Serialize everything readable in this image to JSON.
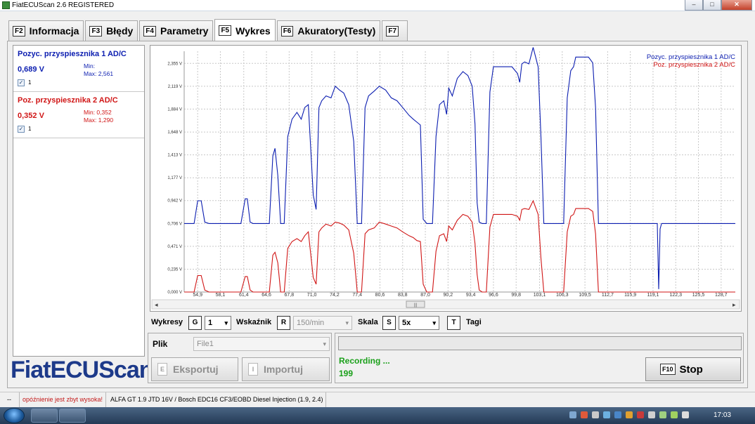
{
  "window": {
    "title": "FiatECUScan 2.6 REGISTERED",
    "minimize": "–",
    "maximize": "□",
    "close": "✕"
  },
  "tabs": [
    {
      "key": "F2",
      "label": "Informacja"
    },
    {
      "key": "F3",
      "label": "Błędy"
    },
    {
      "key": "F4",
      "label": "Parametry"
    },
    {
      "key": "F5",
      "label": "Wykres"
    },
    {
      "key": "F6",
      "label": "Akuratory(Testy)"
    },
    {
      "key": "F7",
      "label": ""
    }
  ],
  "channels": [
    {
      "name": "Pozyc. przyspiesznika 1 AD/C",
      "value": "0,689 V",
      "min": "Min:",
      "max": "Max: 2,561",
      "checked": "✓",
      "check_label": "1",
      "color": "#0b1db0"
    },
    {
      "name": "Poz. przyspiesznika 2 AD/C",
      "value": "0,352 V",
      "min": "Min: 0,352",
      "max": "Max: 1,290",
      "checked": "✓",
      "check_label": "1",
      "color": "#d01515"
    }
  ],
  "logo": "FiatECUScan",
  "chart_data": {
    "type": "line",
    "legend_position": "top-right",
    "grid": true,
    "xlim": [
      53.0,
      130.7
    ],
    "ylim": [
      0.0,
      2.48
    ],
    "y_ticks": [
      "0,000 V",
      "0,235 V",
      "0,471 V",
      "0,706 V",
      "0,942 V",
      "1,177 V",
      "1,413 V",
      "1,648 V",
      "1,884 V",
      "2,119 V",
      "2,355 V"
    ],
    "x_ticks": [
      "54,9",
      "58,1",
      "61,4",
      "64,6",
      "67,8",
      "71,0",
      "74,2",
      "77,4",
      "80,6",
      "83,8",
      "87,0",
      "90,2",
      "93,4",
      "96,6",
      "99,8",
      "103,1",
      "106,3",
      "109,5",
      "112,7",
      "115,9",
      "119,1",
      "122,3",
      "125,5",
      "128,7"
    ],
    "series": [
      {
        "name": "Pozyc. przyspiesznika 1 AD/C",
        "color": "#0b1db0",
        "x": [
          53.0,
          54.4,
          54.9,
          55.4,
          55.9,
          56.5,
          58.1,
          61.0,
          61.6,
          61.9,
          62.3,
          62.7,
          63.6,
          64.3,
          65.0,
          65.5,
          65.8,
          66.2,
          66.6,
          67.1,
          67.6,
          68.2,
          68.9,
          69.5,
          70.0,
          70.5,
          71.2,
          71.6,
          72.0,
          72.4,
          73.0,
          73.7,
          74.3,
          74.9,
          75.5,
          76.2,
          76.9,
          77.4,
          78.0,
          78.5,
          79.0,
          79.8,
          80.5,
          81.4,
          82.2,
          83.0,
          83.8,
          84.7,
          85.3,
          85.8,
          86.3,
          86.7,
          87.2,
          87.6,
          88.0,
          88.5,
          89.0,
          89.6,
          90.0,
          90.3,
          90.8,
          91.5,
          92.3,
          93.0,
          93.6,
          94.0,
          94.3,
          94.6,
          95.0,
          95.6,
          96.1,
          96.6,
          97.0,
          97.6,
          98.4,
          99.2,
          100.0,
          100.3,
          100.6,
          101.0,
          101.6,
          102.2,
          102.9,
          103.3,
          103.7,
          104.2,
          104.7,
          105.1,
          106.5,
          107.0,
          107.5,
          107.9,
          108.2,
          108.7,
          109.4,
          110.0,
          110.6,
          111.0,
          111.4,
          111.8,
          112.5,
          115.0,
          118.0,
          119.5,
          119.7,
          119.9,
          120.1,
          120.3,
          121.0,
          125.0,
          130.7
        ],
        "y": [
          0.706,
          0.706,
          0.94,
          0.94,
          0.72,
          0.706,
          0.706,
          0.706,
          0.96,
          0.96,
          0.72,
          0.706,
          0.706,
          0.706,
          0.706,
          1.4,
          1.48,
          1.2,
          0.706,
          0.706,
          1.6,
          1.78,
          1.85,
          1.78,
          1.9,
          1.93,
          1.0,
          0.85,
          1.9,
          1.97,
          2.02,
          2.0,
          2.12,
          2.08,
          2.05,
          1.93,
          1.55,
          0.706,
          0.706,
          1.9,
          2.02,
          2.07,
          2.12,
          2.08,
          2.0,
          1.97,
          1.9,
          1.82,
          1.78,
          1.75,
          1.72,
          0.75,
          0.706,
          0.706,
          0.706,
          1.6,
          1.93,
          1.97,
          1.83,
          2.1,
          2.02,
          2.2,
          2.27,
          2.23,
          2.12,
          1.73,
          0.92,
          0.72,
          0.706,
          0.706,
          2.06,
          2.32,
          2.32,
          2.32,
          2.32,
          2.32,
          2.25,
          2.16,
          2.35,
          2.37,
          2.35,
          2.52,
          2.32,
          1.6,
          0.706,
          0.706,
          0.706,
          0.706,
          0.706,
          2.0,
          2.28,
          2.32,
          2.42,
          2.42,
          2.42,
          2.42,
          2.36,
          1.9,
          0.706,
          0.706,
          0.706,
          0.706,
          0.706,
          0.706,
          0.706,
          0.03,
          0.65,
          0.706,
          0.706,
          0.706,
          0.706
        ],
        "legend": "Pozyc. przyspiesznika 1 AD/C"
      },
      {
        "name": "Poz. przyspiesznika 2 AD/C",
        "color": "#d01515",
        "x": [
          53.0,
          54.4,
          54.9,
          55.4,
          55.9,
          56.5,
          58.1,
          61.0,
          61.6,
          61.9,
          62.3,
          62.7,
          63.6,
          64.3,
          65.0,
          65.5,
          65.8,
          66.2,
          66.6,
          67.1,
          67.6,
          68.2,
          68.9,
          69.5,
          70.0,
          70.5,
          71.2,
          71.6,
          72.0,
          72.4,
          73.0,
          73.7,
          74.3,
          74.9,
          75.5,
          76.2,
          76.9,
          77.4,
          78.0,
          78.5,
          79.0,
          79.8,
          80.5,
          81.4,
          82.2,
          83.0,
          83.8,
          84.7,
          85.3,
          85.8,
          86.3,
          86.7,
          87.2,
          87.6,
          88.0,
          88.5,
          89.0,
          89.6,
          90.0,
          90.3,
          90.8,
          91.5,
          92.3,
          93.0,
          93.6,
          94.0,
          94.3,
          94.6,
          95.0,
          95.6,
          96.1,
          96.6,
          97.0,
          97.6,
          98.4,
          99.2,
          100.0,
          100.3,
          100.6,
          101.0,
          101.6,
          102.2,
          102.9,
          103.3,
          103.7,
          104.2,
          104.7,
          105.1,
          106.5,
          107.0,
          107.5,
          107.9,
          108.2,
          108.7,
          109.4,
          110.0,
          110.6,
          111.0,
          111.4,
          111.8,
          112.5,
          130.7
        ],
        "y": [
          0.0,
          0.0,
          0.17,
          0.17,
          0.02,
          0.0,
          0.0,
          0.0,
          0.16,
          0.16,
          0.02,
          0.0,
          0.0,
          0.0,
          0.0,
          0.38,
          0.41,
          0.3,
          0.0,
          0.0,
          0.45,
          0.52,
          0.55,
          0.52,
          0.58,
          0.62,
          0.15,
          0.08,
          0.62,
          0.66,
          0.7,
          0.68,
          0.72,
          0.71,
          0.69,
          0.64,
          0.4,
          0.0,
          0.0,
          0.6,
          0.64,
          0.66,
          0.72,
          0.7,
          0.68,
          0.66,
          0.62,
          0.58,
          0.56,
          0.53,
          0.52,
          0.08,
          0.0,
          0.0,
          0.0,
          0.42,
          0.58,
          0.6,
          0.52,
          0.68,
          0.64,
          0.74,
          0.8,
          0.78,
          0.72,
          0.5,
          0.18,
          0.02,
          0.0,
          0.0,
          0.67,
          0.8,
          0.8,
          0.8,
          0.8,
          0.8,
          0.78,
          0.74,
          0.85,
          0.86,
          0.85,
          0.94,
          0.8,
          0.35,
          0.0,
          0.0,
          0.0,
          0.0,
          0.0,
          0.62,
          0.78,
          0.8,
          0.86,
          0.86,
          0.86,
          0.86,
          0.83,
          0.6,
          0.0,
          0.0,
          0.0,
          0.0
        ],
        "legend": "Poz. przyspiesznika 2 AD/C"
      }
    ]
  },
  "scrollbar": {
    "left": "◂",
    "right": "▸",
    "grip": "|||"
  },
  "controls": {
    "charts_label": "Wykresy",
    "charts_key": "G",
    "charts_value": "1",
    "indicator_label": "Wskaźnik",
    "indicator_key": "R",
    "indicator_value": "150/min",
    "scale_label": "Skala",
    "scale_key": "S",
    "scale_value": "5x",
    "tags_key": "T",
    "tags_label": "Tagi",
    "caret": "▾"
  },
  "file": {
    "label": "Plik",
    "value": "File1",
    "export_key": "E",
    "export_label": "Eksportuj",
    "import_key": "I",
    "import_label": "Importuj"
  },
  "status": {
    "recording": "Recording ...",
    "count": "199",
    "stop_key": "F10",
    "stop_label": "Stop"
  },
  "statusbar": {
    "left": "--",
    "warning": "opóźnienie jest zbyt wysoka!",
    "ecu": "ALFA GT 1.9 JTD 16V / Bosch EDC16 CF3/EOBD Diesel Injection (1.9, 2.4)"
  },
  "taskbar": {
    "clock": "17:03"
  }
}
